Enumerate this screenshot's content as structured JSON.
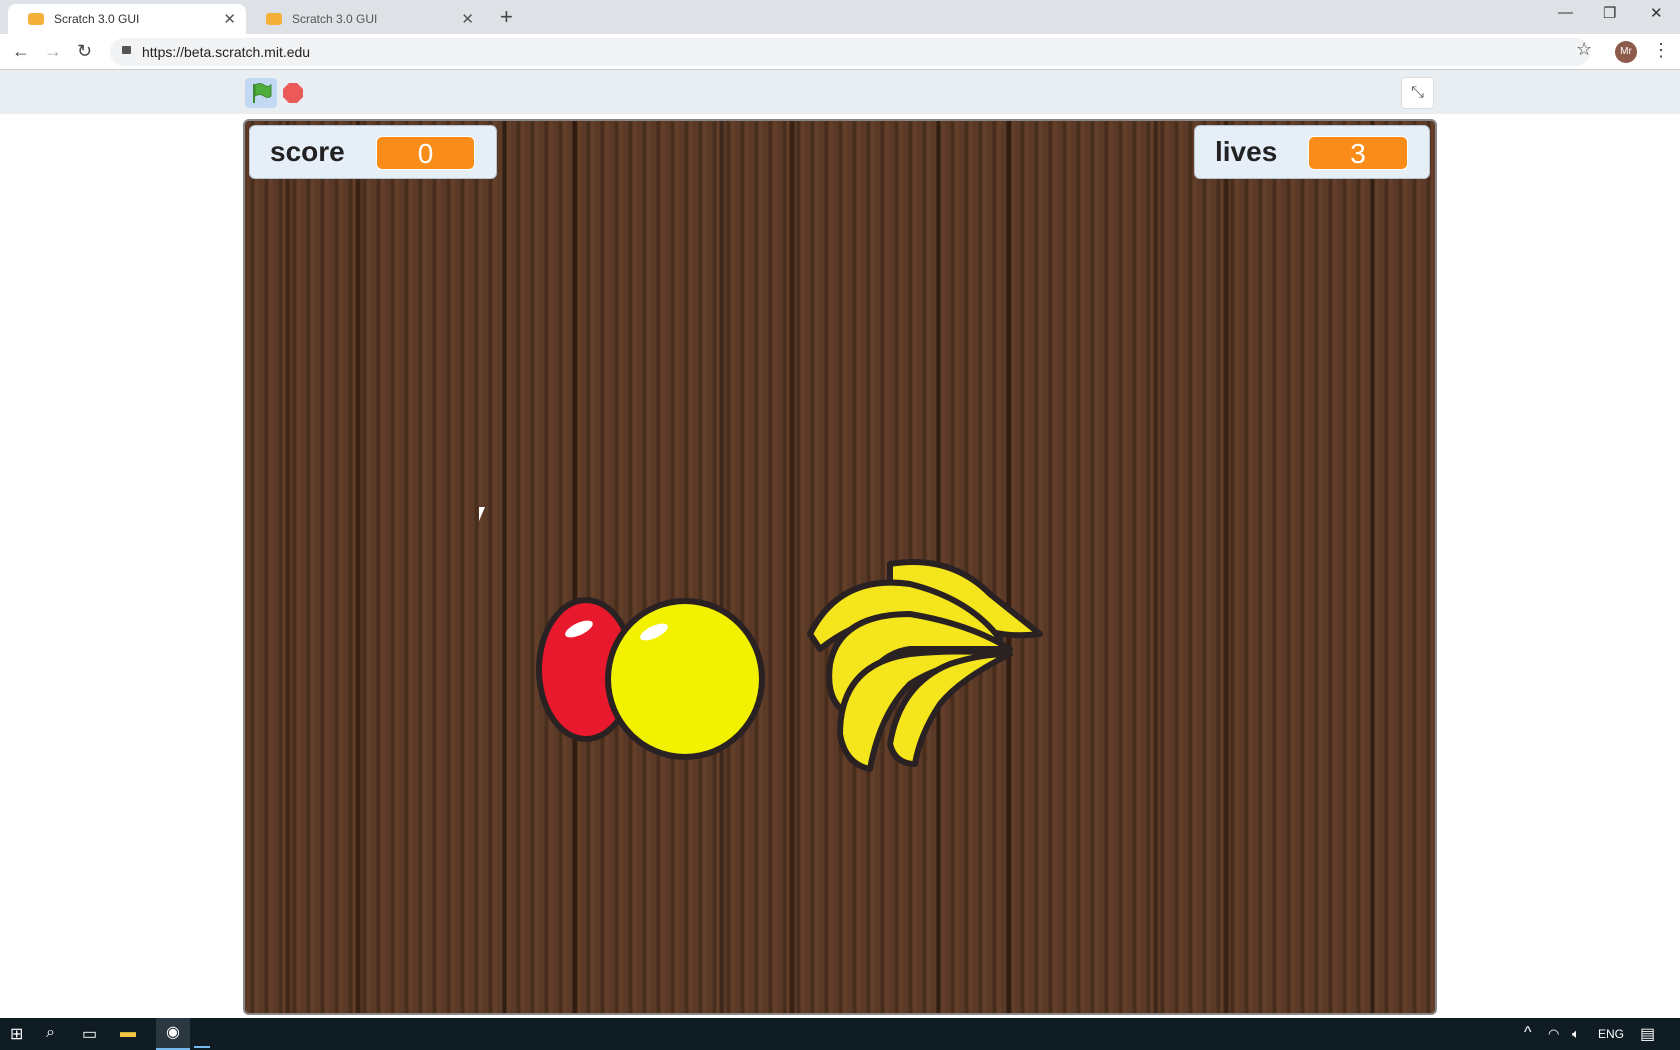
{
  "browser": {
    "tabs": [
      {
        "title": "Scratch 3.0 GUI",
        "active": true
      },
      {
        "title": "Scratch 3.0 GUI",
        "active": false
      }
    ],
    "url": "https://beta.scratch.mit.edu",
    "profile_initials": "Mr"
  },
  "scratch": {
    "green_flag": "green-flag-icon",
    "stop": "stop-icon",
    "fullscreen": "exit-fullscreen-icon"
  },
  "monitors": {
    "score": {
      "label": "score",
      "value": "0"
    },
    "lives": {
      "label": "lives",
      "value": "3"
    }
  },
  "sprites": [
    "apple",
    "bananas"
  ],
  "taskbar": {
    "language": "ENG"
  },
  "colors": {
    "monitor_value": "#fa8c1a",
    "stop": "#ec5959",
    "flag": "#4cad3a"
  }
}
